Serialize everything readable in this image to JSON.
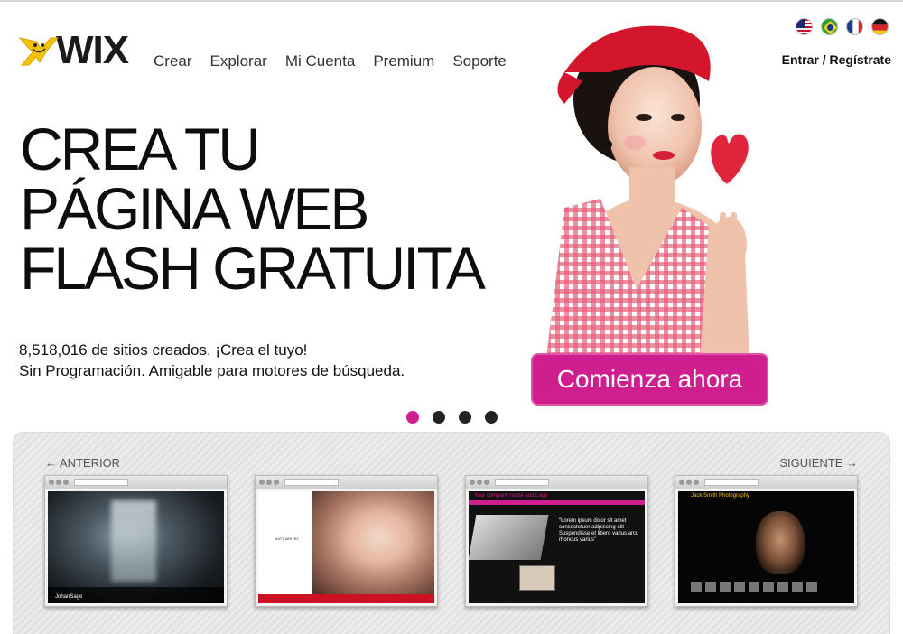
{
  "header": {
    "logo_text": "WIX",
    "nav": [
      "Crear",
      "Explorar",
      "Mi Cuenta",
      "Premium",
      "Soporte"
    ],
    "languages": [
      "us-flag-icon",
      "brazil-flag-icon",
      "france-flag-icon",
      "germany-flag-icon"
    ],
    "login_label": "Entrar / Regístrate"
  },
  "hero": {
    "title_lines": [
      "CREA TU",
      "PÁGINA WEB",
      "FLASH GRATUITA"
    ],
    "subtitle_line1": "8,518,016 de sitios creados. ¡Crea el tuyo!",
    "subtitle_line2": "Sin Programación. Amigable para motores de búsqueda.",
    "cta_label": "Comienza ahora",
    "slides": 4,
    "active_slide": 1
  },
  "gallery": {
    "prev_label": "← ANTERIOR",
    "next_label": "SIGUIENTE →",
    "templates": [
      {
        "site_name": "JohanSage"
      },
      {
        "site_name": "MATT WHITBY"
      },
      {
        "site_name": "Your company name and Logo",
        "quote": "“Lorem ipsum dolor sit amet consectetuer adipiscing elit Suspendisse et libero varius arcu rhoncus varius”"
      },
      {
        "site_name": "Jack Smith Photography"
      }
    ]
  },
  "colors": {
    "accent": "#cf1e8e",
    "text": "#111111"
  }
}
